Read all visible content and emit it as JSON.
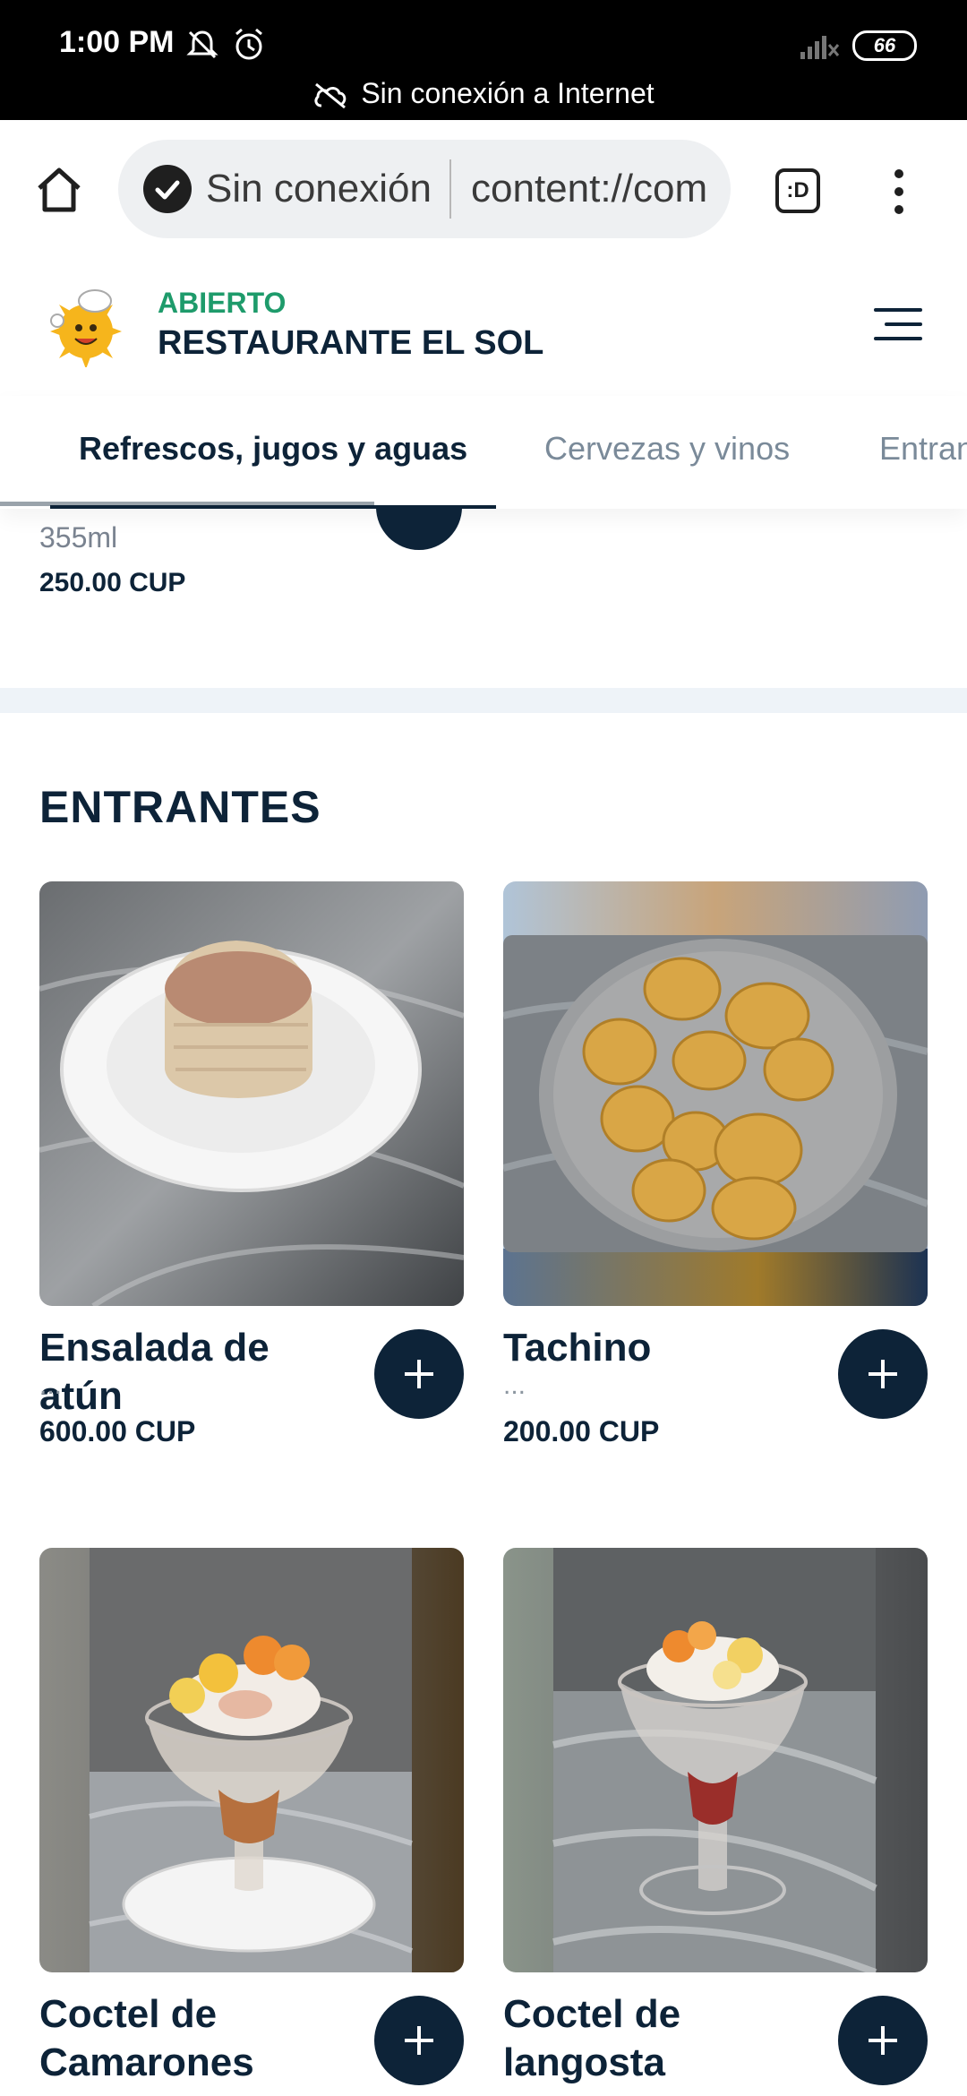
{
  "status_bar": {
    "time": "1:00 PM",
    "battery": "66",
    "offline_message": "Sin conexión a Internet"
  },
  "browser": {
    "offline_label": "Sin conexión",
    "url": "content://com",
    "tab_switcher_label": ":D"
  },
  "restaurant": {
    "status": "ABIERTO",
    "name": "RESTAURANTE EL SOL"
  },
  "tabs": [
    {
      "label": "Refrescos, jugos y aguas",
      "active": true
    },
    {
      "label": "Cervezas y vinos",
      "active": false
    },
    {
      "label": "Entrantes",
      "active": false
    }
  ],
  "previous_item": {
    "size": "355ml",
    "price": "250.00 CUP"
  },
  "section": {
    "title": "ENTRANTES"
  },
  "products": [
    {
      "name": "Ensalada de atún",
      "description": "...",
      "price": "600.00 CUP"
    },
    {
      "name": "Tachino",
      "description": "...",
      "price": "200.00 CUP"
    },
    {
      "name": "Coctel de Camarones",
      "description": "",
      "price": ""
    },
    {
      "name": "Coctel de langosta",
      "description": "",
      "price": ""
    }
  ],
  "colors": {
    "primary": "#0d2338",
    "open_green": "#1e9b6b",
    "divider": "#eef3f8"
  }
}
